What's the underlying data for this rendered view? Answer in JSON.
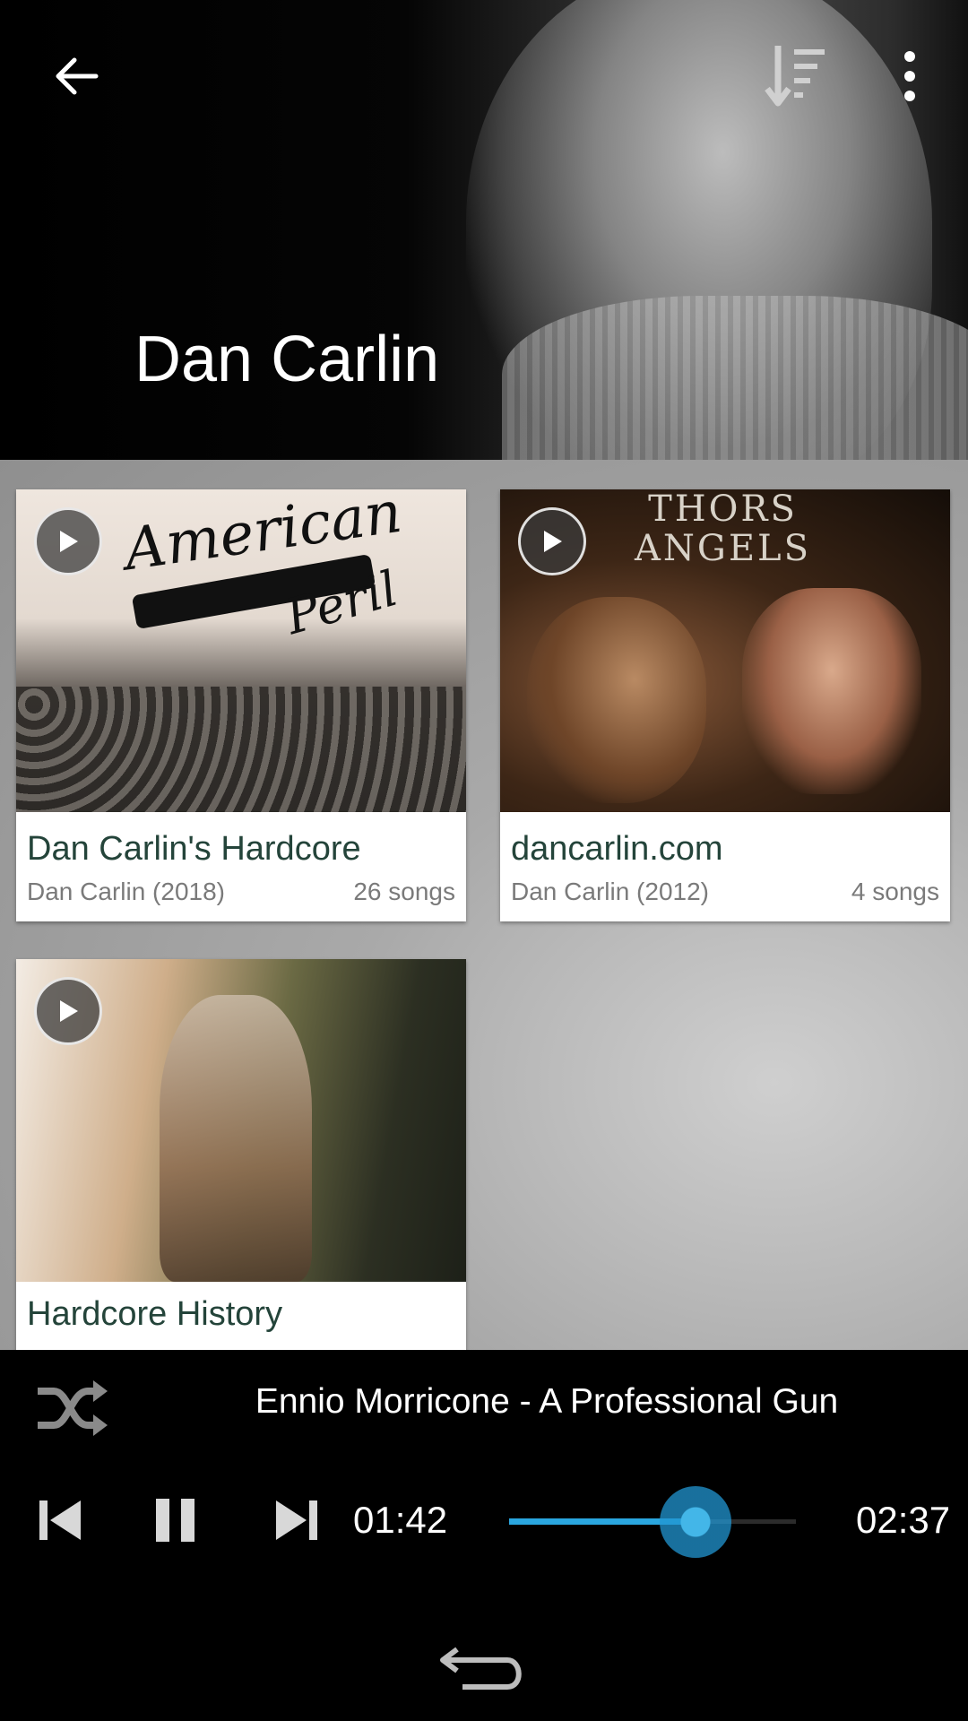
{
  "header": {
    "artist_name": "Dan Carlin",
    "icons": {
      "back": "arrow-left-icon",
      "sort": "sort-icon",
      "more": "more-vertical-icon"
    }
  },
  "albums": [
    {
      "title": "Dan Carlin's Hardcore",
      "subtitle": "Dan Carlin (2018)",
      "count": "26 songs",
      "art_text": [
        "American",
        "Peril"
      ]
    },
    {
      "title": "dancarlin.com",
      "subtitle": "Dan Carlin (2012)",
      "count": "4 songs",
      "art_text": [
        "THORS",
        "ANGELS"
      ]
    },
    {
      "title": "Hardcore History",
      "subtitle": "",
      "count": "",
      "art_text": []
    }
  ],
  "player": {
    "now_playing": "Ennio Morricone - A Professional Gun",
    "elapsed": "01:42",
    "total": "02:37",
    "progress": 0.65,
    "accent_color": "#2aa6df",
    "icons": {
      "shuffle": "shuffle-icon",
      "prev": "skip-previous-icon",
      "pause": "pause-icon",
      "next": "skip-next-icon"
    }
  },
  "navbar": {
    "back_icon": "nav-back-icon"
  }
}
